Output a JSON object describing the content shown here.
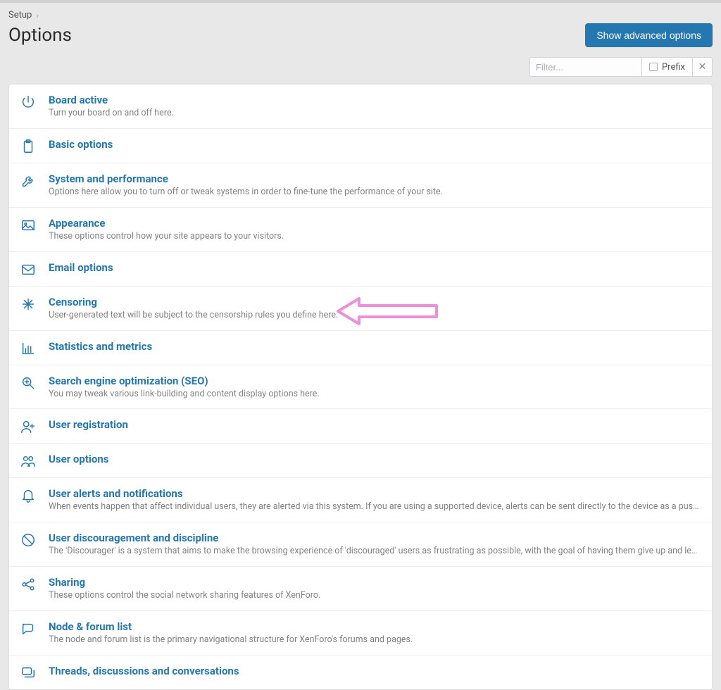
{
  "breadcrumb": {
    "root": "Setup"
  },
  "page": {
    "title": "Options"
  },
  "buttons": {
    "advanced": "Show advanced options"
  },
  "filter": {
    "placeholder": "Filter...",
    "prefix_label": "Prefix"
  },
  "rows": [
    {
      "icon": "power-icon",
      "title": "Board active",
      "desc": "Turn your board on and off here."
    },
    {
      "icon": "clipboard-icon",
      "title": "Basic options",
      "desc": ""
    },
    {
      "icon": "wrench-icon",
      "title": "System and performance",
      "desc": "Options here allow you to turn off or tweak systems in order to fine-tune the performance of your site."
    },
    {
      "icon": "image-icon",
      "title": "Appearance",
      "desc": "These options control how your site appears to your visitors."
    },
    {
      "icon": "envelope-icon",
      "title": "Email options",
      "desc": ""
    },
    {
      "icon": "asterisk-icon",
      "title": "Censoring",
      "desc": "User-generated text will be subject to the censorship rules you define here."
    },
    {
      "icon": "chart-icon",
      "title": "Statistics and metrics",
      "desc": ""
    },
    {
      "icon": "seo-icon",
      "title": "Search engine optimization (SEO)",
      "desc": "You may tweak various link-building and content display options here."
    },
    {
      "icon": "user-add-icon",
      "title": "User registration",
      "desc": ""
    },
    {
      "icon": "users-icon",
      "title": "User options",
      "desc": ""
    },
    {
      "icon": "bell-icon",
      "title": "User alerts and notifications",
      "desc": "When events happen that affect individual users, they are alerted via this system. If you are using a supported device, alerts can be sent directly to the device as a push notification. As large ..."
    },
    {
      "icon": "ban-icon",
      "title": "User discouragement and discipline",
      "desc": "The 'Discourager' is a system that aims to make the browsing experience of 'discouraged' users as frustrating as possible, with the goal of having them give up and leave."
    },
    {
      "icon": "share-icon",
      "title": "Sharing",
      "desc": "These options control the social network sharing features of XenForo."
    },
    {
      "icon": "chat-icon",
      "title": "Node & forum list",
      "desc": "The node and forum list is the primary navigational structure for XenForo's forums and pages."
    },
    {
      "icon": "comments-icon",
      "title": "Threads, discussions and conversations",
      "desc": ""
    }
  ]
}
